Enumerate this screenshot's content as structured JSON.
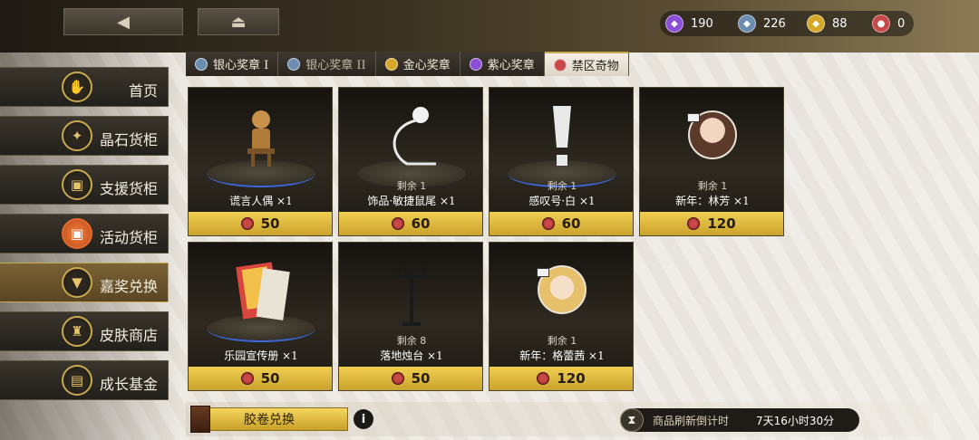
{
  "currencies": [
    {
      "icon": "purple-gem-icon",
      "value": "190",
      "color": "#8a4fd6"
    },
    {
      "icon": "silver-gem-icon",
      "value": "226",
      "color": "#6c8db0"
    },
    {
      "icon": "gold-gem-icon",
      "value": "88",
      "color": "#d6a82a"
    },
    {
      "icon": "red-coin-icon",
      "value": "0",
      "color": "#c94848"
    }
  ],
  "tabs": [
    {
      "label": "银心奖章 I",
      "color": "#6c8db0"
    },
    {
      "label": "银心奖章 II",
      "color": "#6c8db0"
    },
    {
      "label": "金心奖章",
      "color": "#d6a82a"
    },
    {
      "label": "紫心奖章",
      "color": "#8a4fd6"
    },
    {
      "label": "禁区奇物",
      "color": "#c94848"
    }
  ],
  "sidebar": [
    {
      "label": "首页",
      "icon": "hand-icon"
    },
    {
      "label": "晶石货柜",
      "icon": "crystal-icon"
    },
    {
      "label": "支援货柜",
      "icon": "box-icon"
    },
    {
      "label": "活动货柜",
      "icon": "event-box-icon"
    },
    {
      "label": "嘉奖兑换",
      "icon": "medal-icon"
    },
    {
      "label": "皮肤商店",
      "icon": "outfit-icon"
    },
    {
      "label": "成长基金",
      "icon": "chest-icon"
    }
  ],
  "items": [
    {
      "name": "谎言人偶 ×1",
      "remain": "",
      "price": "50"
    },
    {
      "name": "饰品·敏捷鼠尾 ×1",
      "remain": "剩余 1",
      "price": "60"
    },
    {
      "name": "感叹号·白 ×1",
      "remain": "剩余 1",
      "price": "60"
    },
    {
      "name": "新年：林芳 ×1",
      "remain": "剩余 1",
      "price": "120"
    },
    {
      "name": "乐园宣传册 ×1",
      "remain": "",
      "price": "50"
    },
    {
      "name": "落地烛台 ×1",
      "remain": "剩余 8",
      "price": "50"
    },
    {
      "name": "新年：格蕾茜 ×1",
      "remain": "剩余 1",
      "price": "120"
    }
  ],
  "bottom": {
    "exchange_label": "胶卷兑换",
    "info": "i",
    "refresh_label": "商品刷新倒计时",
    "refresh_time": "7天16小时30分"
  }
}
